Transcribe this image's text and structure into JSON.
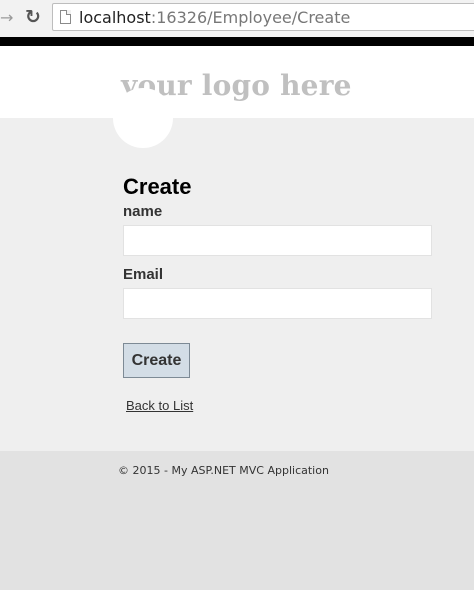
{
  "browser": {
    "url_host": "localhost",
    "url_rest": ":16326/Employee/Create"
  },
  "header": {
    "logo_text": "your logo here"
  },
  "form": {
    "title": "Create",
    "name_label": "name",
    "name_value": "",
    "email_label": "Email",
    "email_value": "",
    "submit_label": "Create",
    "back_link": "Back to List"
  },
  "footer": {
    "copyright": "© 2015 - My ASP.NET MVC Application"
  },
  "icons": {
    "forward": "forward-arrow-icon",
    "reload": "reload-icon",
    "page": "page-icon"
  },
  "colors": {
    "top_bar": "#000000",
    "logo": "#c0c0c0",
    "main_background": "#efefef",
    "footer_background": "#e2e2e2",
    "button": "#d3dde6"
  }
}
